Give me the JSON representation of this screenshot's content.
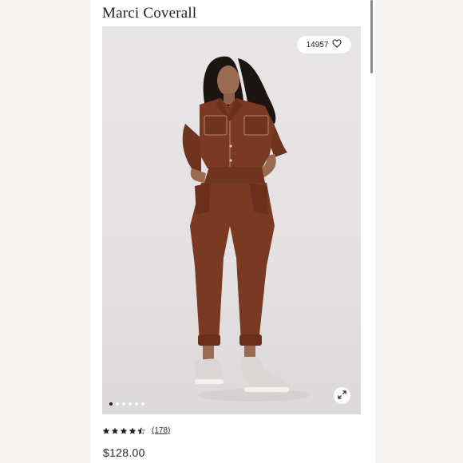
{
  "product": {
    "title": "Marci Coverall",
    "price": "$128.00",
    "rating": 4.5,
    "review_count": "(178)",
    "favorite_count": "14957"
  },
  "gallery": {
    "total_images": 6,
    "active_index": 0,
    "icons": [
      "heart-icon",
      "expand-icon"
    ]
  },
  "colors": {
    "jumpsuit": "#7a3a22",
    "background": "#e5e3e4",
    "star": "#1f1f1f"
  }
}
